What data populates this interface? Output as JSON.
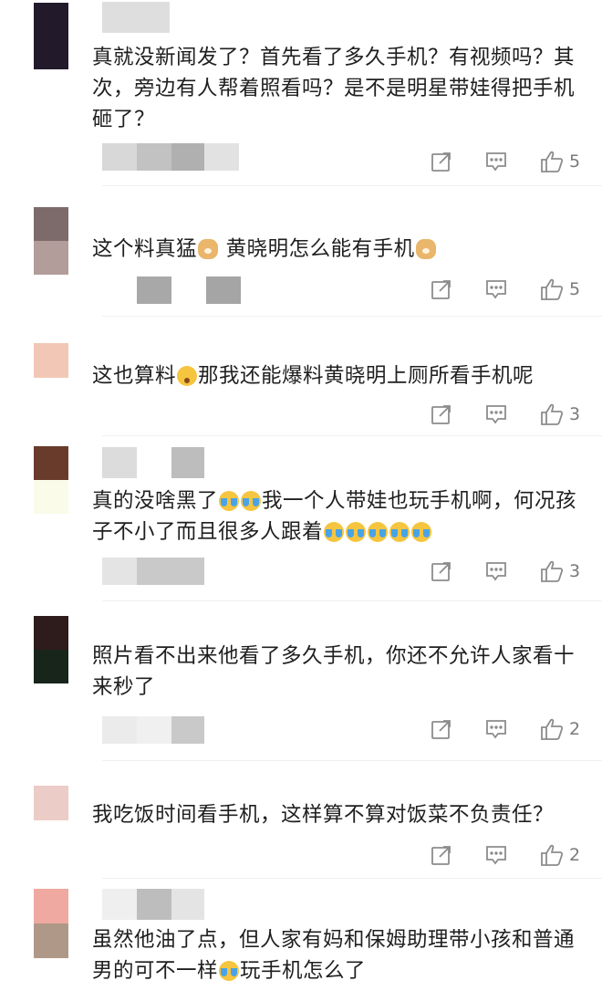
{
  "comments": [
    {
      "avatar_colors": [
        "#22192b",
        "#22192b"
      ],
      "username_blur": [
        "#e0e0e0",
        "#e0e0e0"
      ],
      "meta_blur": [
        "#d8d8d8",
        "#c2c2c2",
        "#b0b0b0",
        "#e2e2e2"
      ],
      "text": "真就没新闻发了？首先看了多久手机？有视频吗？其次，旁边有人帮着照看吗？是不是明星带娃得把手机砸了？",
      "emoji": [],
      "like_count": "5"
    },
    {
      "avatar_colors": [
        "#7d6a6a",
        "#b29d9b"
      ],
      "username_blur": [],
      "meta_blur": [
        "#ffffff",
        "#a8a8a8",
        "#ffffff",
        "#a5a5a5"
      ],
      "text": "这个料真猛",
      "text_b": "黄晓明怎么能有手机",
      "emoji": [
        "dog"
      ],
      "like_count": "5"
    },
    {
      "avatar_colors": [
        "#f3c7b5",
        "#f3c7b5"
      ],
      "username_blur": [],
      "meta_blur": [],
      "text": "这也算料",
      "text_b": "那我还能爆料黄晓明上厕所看手机呢",
      "emoji": [
        "hmm"
      ],
      "like_count": "3"
    },
    {
      "avatar_colors": [
        "#693b2b",
        "#fafbe8"
      ],
      "username_blur": [
        "#dcdcdc",
        "#ffffff",
        "#bdbdbd"
      ],
      "meta_blur": [
        "#e4e4e4",
        "#c9c9c9"
      ],
      "text": "真的没啥黑了",
      "text_b": "我一个人带娃也玩手机啊，何况孩子不小了而且很多人跟着",
      "emoji": [
        "cry"
      ],
      "like_count": "3"
    },
    {
      "avatar_colors": [
        "#2e1b1b",
        "#17251a"
      ],
      "username_blur": [],
      "meta_blur": [
        "#ebebeb",
        "#f0f0f0",
        "#c9c9c9"
      ],
      "text": "照片看不出来他看了多久手机，你还不允许人家看十来秒了",
      "emoji": [],
      "like_count": "2"
    },
    {
      "avatar_colors": [
        "#ebccc6",
        "#ebccc6"
      ],
      "username_blur": [],
      "meta_blur": [],
      "text": "我吃饭时间看手机，这样算不算对饭菜不负责任？",
      "emoji": [],
      "like_count": "2"
    },
    {
      "avatar_colors": [
        "#f0a9a1",
        "#b09888"
      ],
      "username_blur": [
        "#efefef",
        "#bdbdbd",
        "#e4e4e4"
      ],
      "meta_blur": [],
      "text": "虽然他油了点，但人家有妈和保姆助理带小孩和普通男的可不一样",
      "text_b": "玩手机怎么了",
      "emoji": [
        "cry"
      ],
      "like_count": ""
    }
  ],
  "icons": {
    "share": "share-icon",
    "reply": "comment-icon",
    "like": "thumbs-up-icon"
  },
  "colors": {
    "icon": "#8c8c8c",
    "divider": "#efefef",
    "text": "#1f1f1f"
  }
}
